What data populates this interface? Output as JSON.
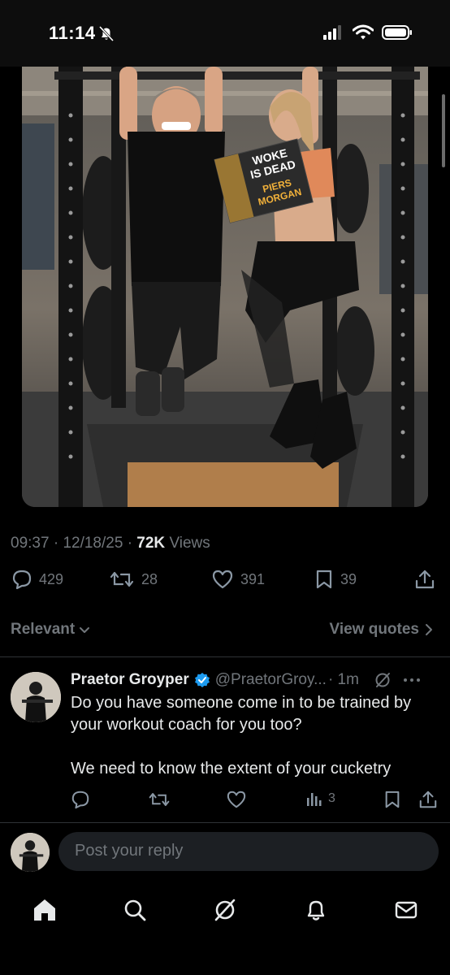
{
  "status_bar": {
    "time": "11:14"
  },
  "tweet": {
    "time": "09:37",
    "date": "12/18/25",
    "views_count": "72K",
    "views_label": "Views",
    "book_title": [
      "WOKE",
      "IS DEAD"
    ],
    "book_author": [
      "PIERS",
      "MORGAN"
    ],
    "replies": "429",
    "reposts": "28",
    "likes": "391",
    "bookmarks": "39"
  },
  "sort": {
    "label": "Relevant",
    "view_quotes": "View quotes"
  },
  "reply": {
    "name": "Praetor Groyper",
    "handle": "@PraetorGroy...",
    "time": "· 1m",
    "line1": "Do you have someone come in to be trained by your workout coach for you too?",
    "line2": "We need to know the extent of your cucketry",
    "views": "3"
  },
  "compose": {
    "placeholder": "Post your reply"
  },
  "colors": {
    "background": "#000000",
    "muted": "#71767b",
    "text": "#e7e9ea",
    "verified": "#1d9bf0"
  }
}
